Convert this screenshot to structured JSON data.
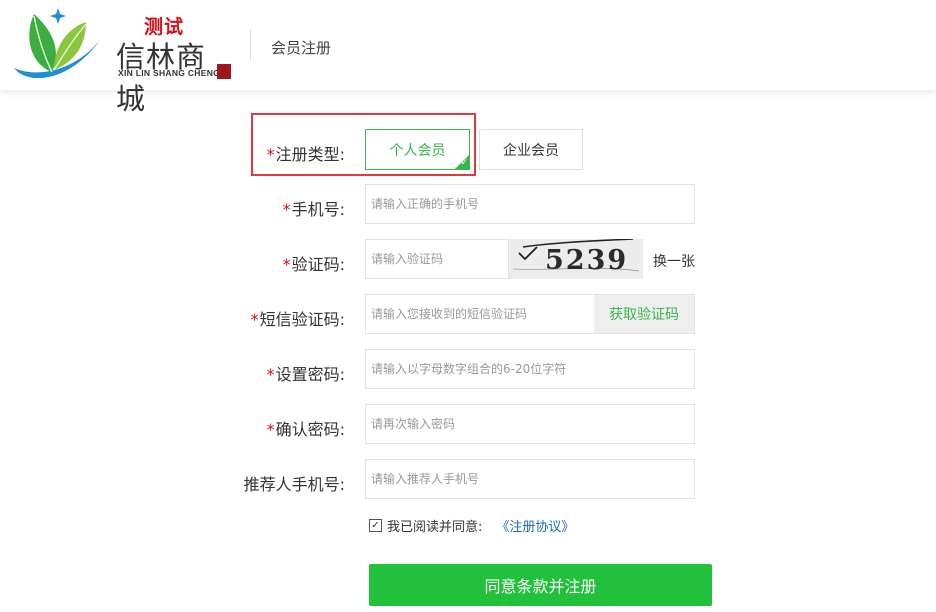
{
  "header": {
    "logo_tag": "测试",
    "logo_name": "信林商城",
    "logo_pinyin": "XIN LIN SHANG CHENG",
    "page_title": "会员注册"
  },
  "form": {
    "required_mark": "*",
    "type_label": "注册类型:",
    "type_personal": "个人会员",
    "type_enterprise": "企业会员",
    "phone_label": "手机号:",
    "phone_placeholder": "请输入正确的手机号",
    "captcha_label": "验证码:",
    "captcha_placeholder": "请输入验证码",
    "captcha_value": "5239",
    "captcha_refresh": "换一张",
    "sms_label": "短信验证码:",
    "sms_placeholder": "请输入您接收到的短信验证码",
    "sms_button": "获取验证码",
    "password_label": "设置密码:",
    "password_placeholder": "请输入以字母数字组合的6-20位字符",
    "confirm_label": "确认密码:",
    "confirm_placeholder": "请再次输入密码",
    "referrer_label": "推荐人手机号:",
    "referrer_placeholder": "请输入推荐人手机号",
    "agree_text": "我已阅读并同意:",
    "agree_link": "《注册协议》",
    "agree_checked": true,
    "submit": "同意条款并注册"
  },
  "colors": {
    "green": "#39b54a",
    "button_green": "#22c13b",
    "required_red": "#d0121b",
    "highlight_red": "#e1393f",
    "link_blue": "#1a6ab8"
  }
}
